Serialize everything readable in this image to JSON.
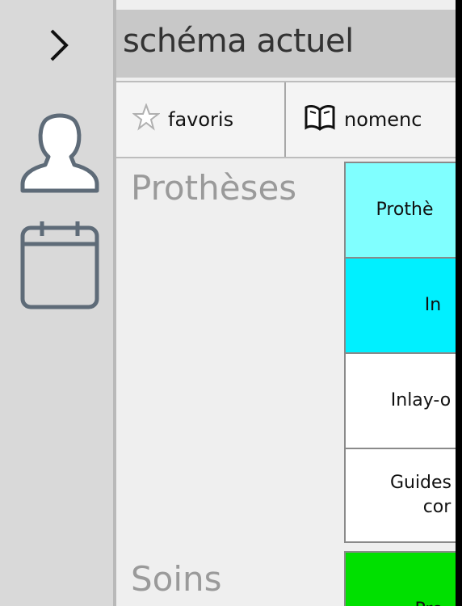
{
  "sidebar": {
    "icons": [
      "chevron-right-icon",
      "user-icon",
      "calendar-icon"
    ]
  },
  "header": {
    "title": "schéma actuel"
  },
  "tabs": [
    {
      "label": "favoris",
      "icon": "star-icon"
    },
    {
      "label": "nomenc",
      "icon": "book-icon"
    }
  ],
  "sections": [
    {
      "title": "Prothèses",
      "cells": [
        {
          "label": "Prothè",
          "color": "#80ffff"
        },
        {
          "label": "In",
          "color": "#00f0ff"
        },
        {
          "label": "Inlay-o",
          "color": "#ffffff"
        },
        {
          "label_line1": "Guides",
          "label_line2": "cor",
          "color": "#ffffff"
        }
      ]
    },
    {
      "title": "Soins",
      "cells": [
        {
          "label": "Pro",
          "color": "#00e000"
        }
      ]
    }
  ],
  "colors": {
    "sidebar_bg": "#d9d9d9",
    "icon_stroke": "#5e6b78",
    "titlebar_bg": "#c8c8c8",
    "section_title": "#9a9a9a"
  }
}
